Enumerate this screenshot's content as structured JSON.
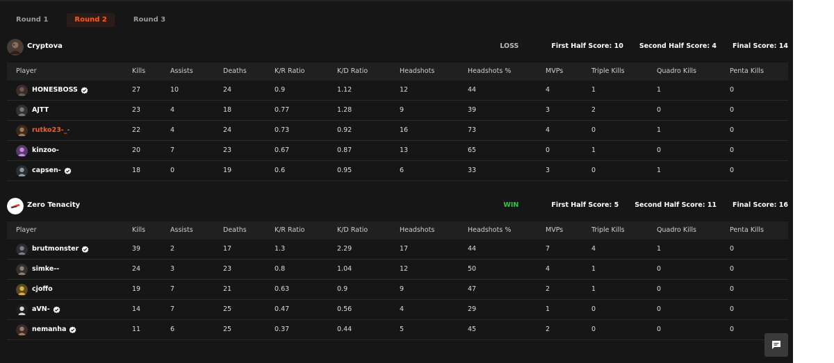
{
  "tabs": [
    "Round 1",
    "Round 2",
    "Round 3"
  ],
  "active_tab": 1,
  "columns": [
    "Player",
    "Kills",
    "Assists",
    "Deaths",
    "K/R Ratio",
    "K/D Ratio",
    "Headshots",
    "Headshots %",
    "MVPs",
    "Triple Kills",
    "Quadro Kills",
    "Penta Kills"
  ],
  "teams": [
    {
      "name": "Cryptova",
      "result": "LOSS",
      "first_half": "First Half Score: 10",
      "second_half": "Second Half Score: 4",
      "final": "Final Score: 14",
      "players": [
        {
          "name": "HONESBOSS",
          "verified": true,
          "highlight": false,
          "stats": [
            "27",
            "10",
            "24",
            "0.9",
            "1.12",
            "12",
            "44",
            "4",
            "1",
            "1",
            "0"
          ]
        },
        {
          "name": "AJTT",
          "verified": false,
          "highlight": false,
          "stats": [
            "23",
            "4",
            "18",
            "0.77",
            "1.28",
            "9",
            "39",
            "3",
            "2",
            "0",
            "0"
          ]
        },
        {
          "name": "rutko23-_-",
          "verified": false,
          "highlight": true,
          "stats": [
            "22",
            "4",
            "24",
            "0.73",
            "0.92",
            "16",
            "73",
            "4",
            "0",
            "1",
            "0"
          ]
        },
        {
          "name": "kinzoo-",
          "verified": false,
          "highlight": false,
          "stats": [
            "20",
            "7",
            "23",
            "0.67",
            "0.87",
            "13",
            "65",
            "0",
            "1",
            "0",
            "0"
          ]
        },
        {
          "name": "capsen-",
          "verified": true,
          "highlight": false,
          "stats": [
            "18",
            "0",
            "19",
            "0.6",
            "0.95",
            "6",
            "33",
            "3",
            "0",
            "1",
            "0"
          ]
        }
      ]
    },
    {
      "name": "Zero Tenacity",
      "result": "WIN",
      "first_half": "First Half Score: 5",
      "second_half": "Second Half Score: 11",
      "final": "Final Score: 16",
      "players": [
        {
          "name": "brutmonster",
          "verified": true,
          "highlight": false,
          "stats": [
            "39",
            "2",
            "17",
            "1.3",
            "2.29",
            "17",
            "44",
            "7",
            "4",
            "1",
            "0"
          ]
        },
        {
          "name": "simke--",
          "verified": false,
          "highlight": false,
          "stats": [
            "24",
            "3",
            "23",
            "0.8",
            "1.04",
            "12",
            "50",
            "4",
            "1",
            "0",
            "0"
          ]
        },
        {
          "name": "cjoffo",
          "verified": false,
          "highlight": false,
          "stats": [
            "19",
            "7",
            "21",
            "0.63",
            "0.9",
            "9",
            "47",
            "2",
            "1",
            "0",
            "0"
          ]
        },
        {
          "name": "aVN-",
          "verified": true,
          "highlight": false,
          "stats": [
            "14",
            "7",
            "25",
            "0.47",
            "0.56",
            "4",
            "29",
            "1",
            "0",
            "0",
            "0"
          ]
        },
        {
          "name": "nemanha",
          "verified": true,
          "highlight": false,
          "stats": [
            "11",
            "6",
            "25",
            "0.37",
            "0.44",
            "5",
            "45",
            "2",
            "0",
            "0",
            "0"
          ]
        }
      ]
    }
  ],
  "colors": {
    "accent": "#ff5a1f",
    "win": "#37c24c",
    "loss": "#bdbdbd",
    "panel": "#161616"
  },
  "icons": {
    "verified": "verified-check-icon",
    "chat": "chat-bubble-icon"
  }
}
